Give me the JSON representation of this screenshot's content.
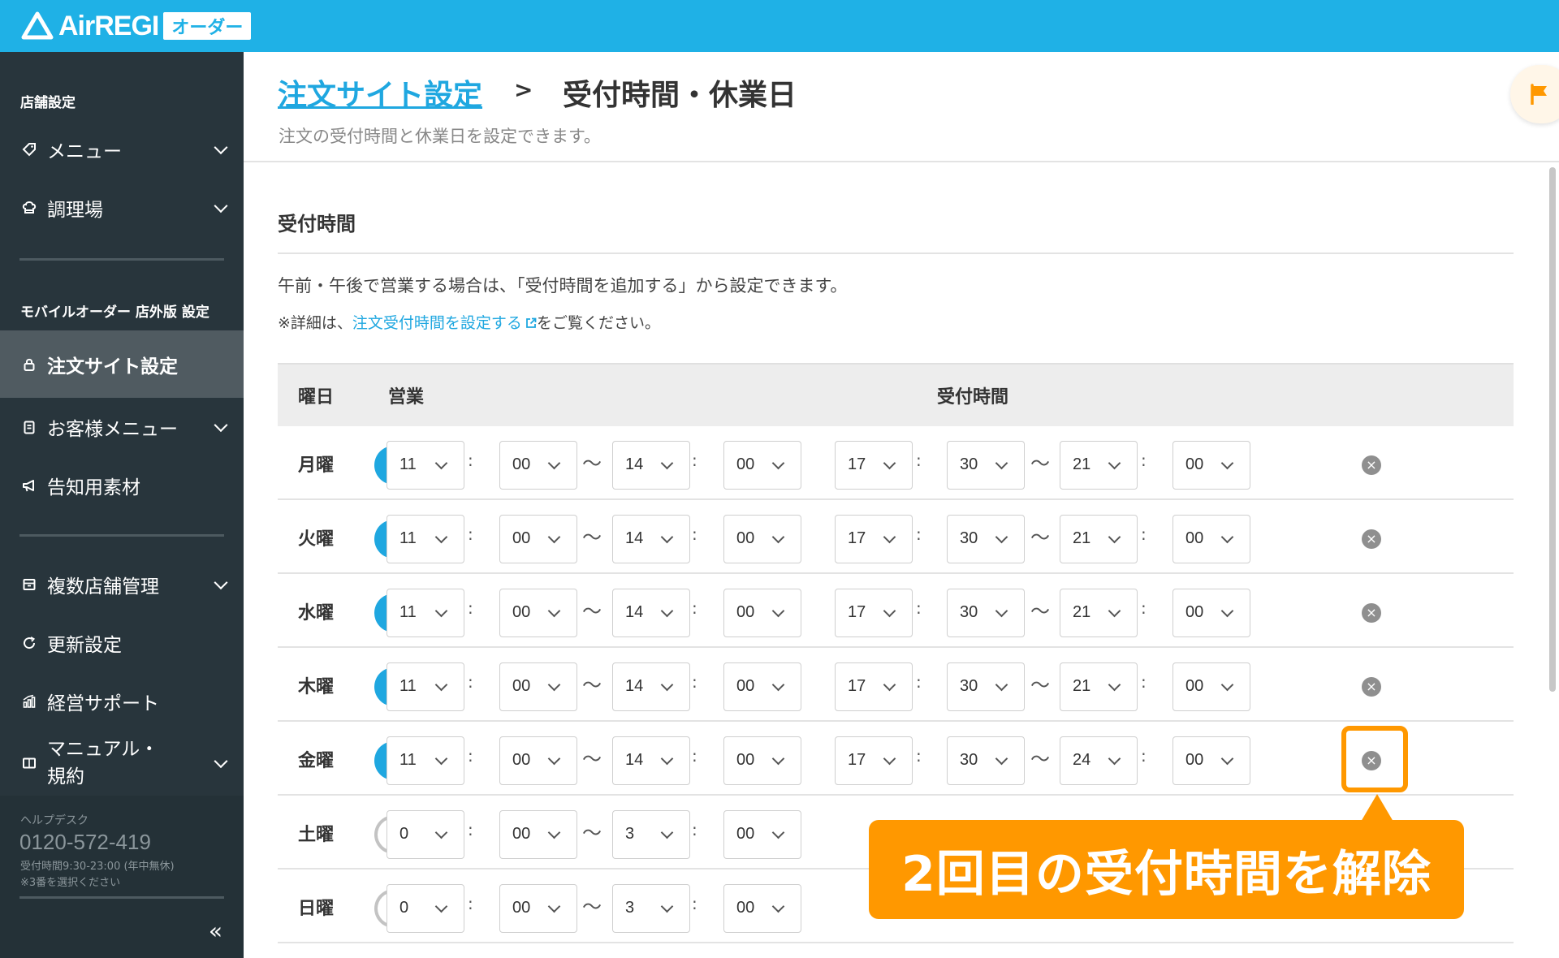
{
  "app": {
    "brand": "AirREGI",
    "badge": "オーダー"
  },
  "sidebar": {
    "section1": "店舗設定",
    "item_menu": "メニュー",
    "item_kitchen": "調理場",
    "section2": "モバイルオーダー 店外版 設定",
    "item_order_site": "注文サイト設定",
    "item_customer_menu": "お客様メニュー",
    "item_promo": "告知用素材",
    "item_multi_store": "複数店舗管理",
    "item_update": "更新設定",
    "item_support": "経営サポート",
    "item_manual_line1": "マニュアル・",
    "item_manual_line2": "規約",
    "help": {
      "label": "ヘルプデスク",
      "phone": "0120-572-419",
      "hours": "受付時間9:30-23:00 (年中無休)",
      "note": "※3番を選択ください"
    },
    "collapse": "«"
  },
  "header": {
    "breadcrumb_link": "注文サイト設定",
    "breadcrumb_sep": ">",
    "breadcrumb_current": "受付時間・休業日",
    "subtitle": "注文の受付時間と休業日を設定できます。"
  },
  "section": {
    "title": "受付時間",
    "desc1": "午前・午後で営業する場合は、「受付時間を追加する」から設定できます。",
    "desc2_prefix": "※詳細は、",
    "desc2_link": "注文受付時間を設定する",
    "desc2_suffix": "をご覧ください。"
  },
  "table": {
    "headers": [
      "曜日",
      "営業",
      "受付時間"
    ],
    "rows": [
      {
        "day": "月曜",
        "open": true,
        "t": [
          "11",
          "00",
          "14",
          "00",
          "17",
          "30",
          "21",
          "00"
        ]
      },
      {
        "day": "火曜",
        "open": true,
        "t": [
          "11",
          "00",
          "14",
          "00",
          "17",
          "30",
          "21",
          "00"
        ]
      },
      {
        "day": "水曜",
        "open": true,
        "t": [
          "11",
          "00",
          "14",
          "00",
          "17",
          "30",
          "21",
          "00"
        ]
      },
      {
        "day": "木曜",
        "open": true,
        "t": [
          "11",
          "00",
          "14",
          "00",
          "17",
          "30",
          "21",
          "00"
        ]
      },
      {
        "day": "金曜",
        "open": true,
        "t": [
          "11",
          "00",
          "14",
          "00",
          "17",
          "30",
          "24",
          "00"
        ]
      },
      {
        "day": "土曜",
        "open": false,
        "t": [
          "0",
          "00",
          "3",
          "00"
        ]
      },
      {
        "day": "日曜",
        "open": false,
        "t": [
          "0",
          "00",
          "3",
          "00"
        ]
      }
    ],
    "colon": ":",
    "tilde": "〜",
    "delete_glyph": "×"
  },
  "callout": {
    "text": "2回目の受付時間を解除"
  },
  "colors": {
    "topbar": "#1fb1e6",
    "sidebar": "#28353c",
    "accent": "#1fa7e0",
    "highlight": "#ff9800"
  }
}
